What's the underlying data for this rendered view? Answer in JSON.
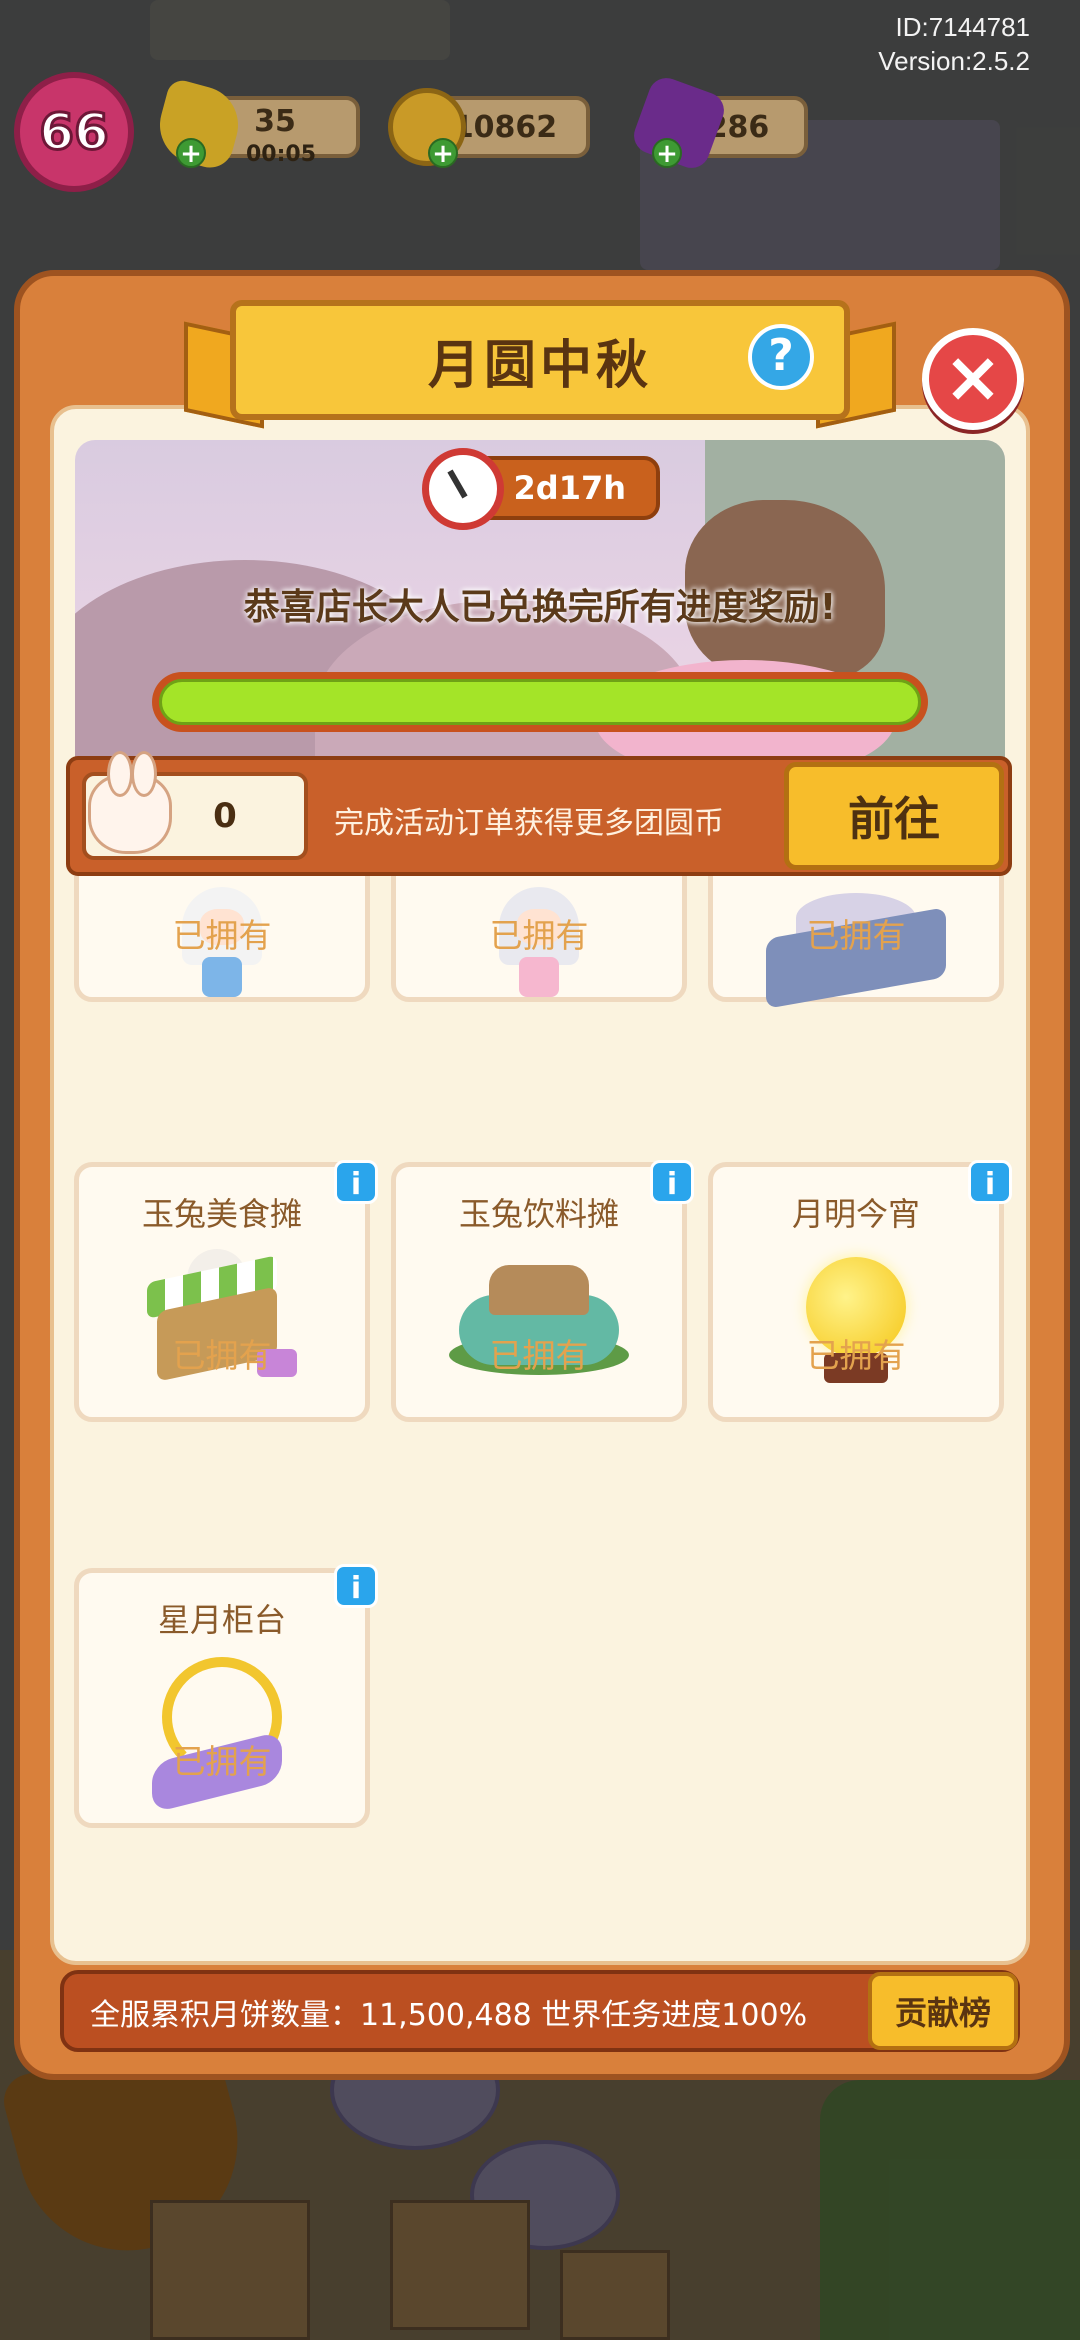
{
  "debug": {
    "id": "ID:7144781",
    "version": "Version:2.5.2"
  },
  "hud": {
    "level": "66",
    "energy": "35",
    "energy_timer": "00:05",
    "coins": "10862",
    "gems": "286"
  },
  "event": {
    "title": "月圆中秋",
    "time_left": "2d17h",
    "congrats": "恭喜店长大人已兑换完所有进度奖励!",
    "progress": 1.0,
    "currency_amount": "0",
    "currency_hint": "完成活动订单获得更多团圆币",
    "go_label": "前往"
  },
  "rewards": [
    {
      "name": "",
      "status": "已拥有",
      "icon": "girl-character",
      "info": false
    },
    {
      "name": "",
      "status": "已拥有",
      "icon": "boy-character",
      "info": false
    },
    {
      "name": "",
      "status": "已拥有",
      "icon": "rabbit-booth",
      "info": false
    },
    {
      "name": "玉兔美食摊",
      "status": "已拥有",
      "icon": "food-stall",
      "info": true
    },
    {
      "name": "玉兔饮料摊",
      "status": "已拥有",
      "icon": "drink-stall",
      "info": true
    },
    {
      "name": "月明今宵",
      "status": "已拥有",
      "icon": "moon-decoration",
      "info": true
    },
    {
      "name": "星月柜台",
      "status": "已拥有",
      "icon": "star-moon-counter",
      "info": true
    }
  ],
  "footer": {
    "summary": "全服累积月饼数量：11,500,488  世界任务进度100%",
    "rank_label": "贡献榜"
  },
  "colors": {
    "panel": "#d9803b",
    "accent": "#f7bd2b",
    "progress": "#a4e428",
    "owned_text": "#e3a24e"
  }
}
